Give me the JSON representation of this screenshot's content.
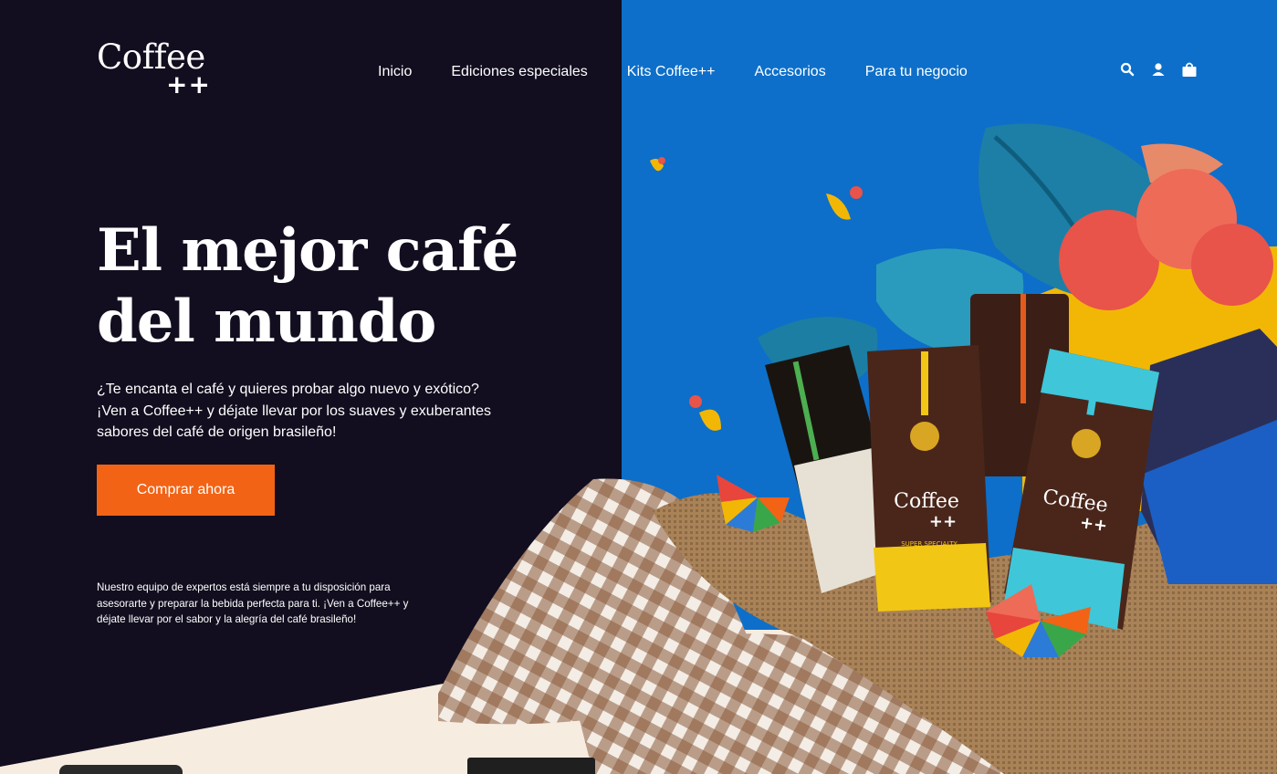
{
  "brand": {
    "name": "Coffee",
    "suffix": "++"
  },
  "nav": {
    "items": [
      {
        "label": "Inicio"
      },
      {
        "label": "Ediciones especiales"
      },
      {
        "label": "Kits Coffee++"
      },
      {
        "label": "Accesorios"
      },
      {
        "label": "Para tu negocio"
      }
    ],
    "icons": [
      "search-icon",
      "user-icon",
      "shopping-bag-icon"
    ]
  },
  "hero": {
    "title_line1": "El mejor café",
    "title_line2": "del mundo",
    "subtitle": "¿Te encanta el café y quieres probar algo nuevo y exótico? ¡Ven a Coffee++ y déjate llevar por los suaves y exuberantes sabores del café de origen brasileño!",
    "cta_label": "Comprar ahora",
    "note": "Nuestro equipo de expertos está siempre a tu disposición para asesorarte y preparar la bebida perfecta para ti. ¡Ven a Coffee++ y déjate llevar por el sabor y la alegría del café brasileño!"
  },
  "product_image": {
    "bag_brand": "Coffee",
    "bag_suffix": "++",
    "bag_tag": "SUPER SPECIALTY"
  },
  "colors": {
    "dark_bg": "#120e1f",
    "blue_bg": "#0d6fc9",
    "accent": "#f26316",
    "yellow": "#f2b705",
    "floor": "#f7ece0"
  }
}
